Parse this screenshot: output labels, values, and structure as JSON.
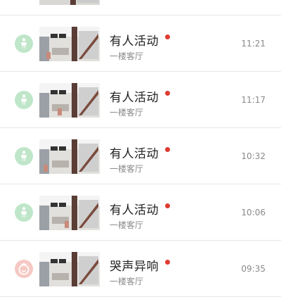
{
  "colors": {
    "person_badge": "#bfe6c9",
    "cry_badge": "#f6c9c4",
    "unread_dot": "#e03a32"
  },
  "events": [
    {
      "type": "person",
      "icon": "person-icon",
      "title": "",
      "location": "",
      "time": ""
    },
    {
      "type": "person",
      "icon": "person-icon",
      "title": "有人活动",
      "location": "一楼客厅",
      "time": "11:21",
      "unread": true
    },
    {
      "type": "person",
      "icon": "person-icon",
      "title": "有人活动",
      "location": "一楼客厅",
      "time": "11:17",
      "unread": true
    },
    {
      "type": "person",
      "icon": "person-icon",
      "title": "有人活动",
      "location": "一楼客厅",
      "time": "10:32",
      "unread": true
    },
    {
      "type": "person",
      "icon": "person-icon",
      "title": "有人活动",
      "location": "一楼客厅",
      "time": "10:06",
      "unread": true
    },
    {
      "type": "cry",
      "icon": "crying-baby-icon",
      "title": "哭声异响",
      "location": "一楼客厅",
      "time": "09:35",
      "unread": true
    }
  ]
}
